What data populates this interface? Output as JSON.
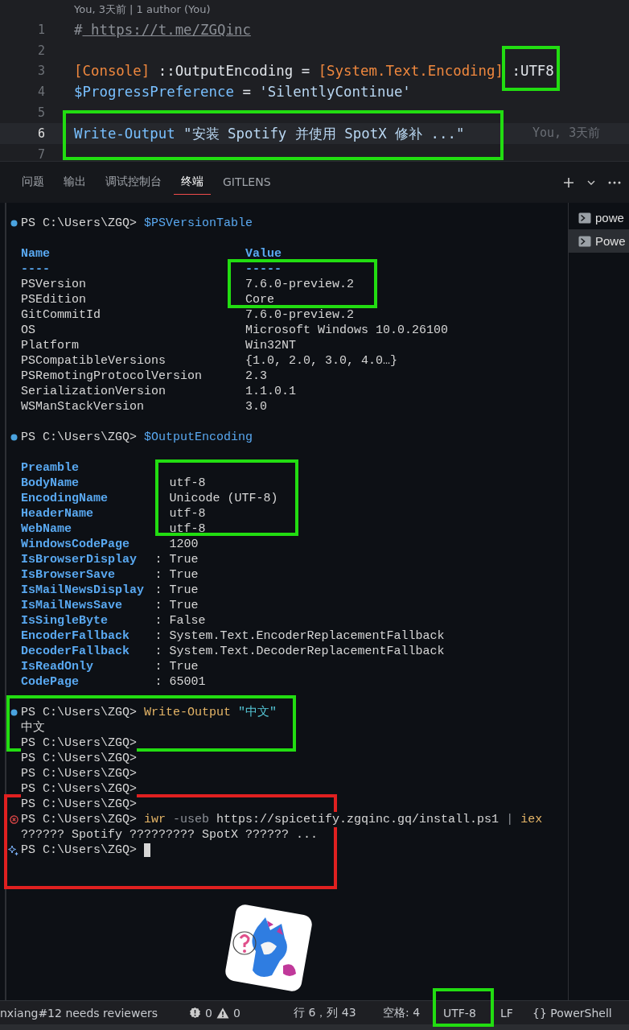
{
  "editor": {
    "blame_header": "You, 3天前 | 1 author (You)",
    "lines": [
      {
        "number": "1",
        "current": false,
        "tokens": [
          {
            "kind": "comment",
            "text": "#"
          },
          {
            "kind": "link",
            "text": "https://t.me/ZGQinc"
          }
        ]
      },
      {
        "number": "2",
        "current": false
      },
      {
        "number": "3",
        "current": false,
        "tokens": [
          {
            "kind": "type",
            "text": "[Console]"
          },
          {
            "kind": "plain",
            "text": "::OutputEncoding ="
          },
          {
            "kind": "type",
            "text": "[System.Text.Encoding]"
          },
          {
            "kind": "plain",
            "text": ":UTF8"
          }
        ]
      },
      {
        "number": "4",
        "current": false,
        "tokens": [
          {
            "kind": "variable",
            "text": "$ProgressPreference"
          },
          {
            "kind": "plain",
            "text": "="
          },
          {
            "kind": "string",
            "text": "'SilentlyContinue'"
          }
        ]
      },
      {
        "number": "5",
        "current": false
      },
      {
        "number": "6",
        "current": true,
        "blame": "You, 3天前",
        "tokens": [
          {
            "kind": "command",
            "text": "Write-Output"
          },
          {
            "kind": "string",
            "text": "\"安装 Spotify 并使用 SpotX 修补 ...\""
          }
        ]
      },
      {
        "number": "7",
        "current": false
      }
    ]
  },
  "panel_tabs": [
    {
      "label": "问题",
      "selected": false
    },
    {
      "label": "输出",
      "selected": false
    },
    {
      "label": "调试控制台",
      "selected": false
    },
    {
      "label": "终端",
      "selected": true
    },
    {
      "label": "GITLENS",
      "selected": false
    }
  ],
  "terminal": {
    "lines": [
      {
        "kind": "prompt",
        "marker": {
          "kind": "success"
        },
        "prompt": "PS C:\\Users\\ZGQ>",
        "tokens": [
          {
            "kind": "variable",
            "text": "$PSVersionTable"
          }
        ]
      },
      {
        "kind": "blank"
      },
      {
        "kind": "table-head",
        "name": "Name",
        "value": "Value"
      },
      {
        "kind": "table-rule",
        "name": "----",
        "value": "-----"
      },
      {
        "kind": "table-row",
        "name": "PSVersion",
        "value": "7.6.0-preview.2"
      },
      {
        "kind": "table-row",
        "name": "PSEdition",
        "value": "Core"
      },
      {
        "kind": "table-row",
        "name": "GitCommitId",
        "value": "7.6.0-preview.2"
      },
      {
        "kind": "table-row",
        "name": "OS",
        "value": "Microsoft Windows 10.0.26100"
      },
      {
        "kind": "table-row",
        "name": "Platform",
        "value": "Win32NT"
      },
      {
        "kind": "table-row",
        "name": "PSCompatibleVersions",
        "value": "{1.0, 2.0, 3.0, 4.0…}"
      },
      {
        "kind": "table-row",
        "name": "PSRemotingProtocolVersion",
        "value": "2.3"
      },
      {
        "kind": "table-row",
        "name": "SerializationVersion",
        "value": "1.1.0.1"
      },
      {
        "kind": "table-row",
        "name": "WSManStackVersion",
        "value": "3.0"
      },
      {
        "kind": "blank"
      },
      {
        "kind": "prompt",
        "marker": {
          "kind": "success"
        },
        "prompt": "PS C:\\Users\\ZGQ>",
        "tokens": [
          {
            "kind": "variable",
            "text": "$OutputEncoding"
          }
        ]
      },
      {
        "kind": "blank"
      },
      {
        "kind": "prop-row",
        "name": "Preamble"
      },
      {
        "kind": "prop-row",
        "name": "BodyName",
        "value": "utf-8"
      },
      {
        "kind": "prop-row",
        "name": "EncodingName",
        "value": "Unicode (UTF-8)"
      },
      {
        "kind": "prop-row",
        "name": "HeaderName",
        "value": "utf-8"
      },
      {
        "kind": "prop-row",
        "name": "WebName",
        "value": "utf-8"
      },
      {
        "kind": "prop-row",
        "name": "WindowsCodePage",
        "value": "1200"
      },
      {
        "kind": "prop-row",
        "name": "IsBrowserDisplay",
        "separator": ":",
        "value": "True"
      },
      {
        "kind": "prop-row",
        "name": "IsBrowserSave",
        "separator": ":",
        "value": "True"
      },
      {
        "kind": "prop-row",
        "name": "IsMailNewsDisplay",
        "separator": ":",
        "value": "True"
      },
      {
        "kind": "prop-row",
        "name": "IsMailNewsSave",
        "separator": ":",
        "value": "True"
      },
      {
        "kind": "prop-row",
        "name": "IsSingleByte",
        "separator": ":",
        "value": "False"
      },
      {
        "kind": "prop-row",
        "name": "EncoderFallback",
        "separator": ":",
        "value": "System.Text.EncoderReplacementFallback"
      },
      {
        "kind": "prop-row",
        "name": "DecoderFallback",
        "separator": ":",
        "value": "System.Text.DecoderReplacementFallback"
      },
      {
        "kind": "prop-row",
        "name": "IsReadOnly",
        "separator": ":",
        "value": "True"
      },
      {
        "kind": "prop-row",
        "name": "CodePage",
        "separator": ":",
        "value": "65001"
      },
      {
        "kind": "blank"
      },
      {
        "kind": "prompt",
        "marker": {
          "kind": "success"
        },
        "prompt": "PS C:\\Users\\ZGQ>",
        "tokens": [
          {
            "kind": "command",
            "text": "Write-Output"
          },
          {
            "kind": "string",
            "text": "\"中文\""
          }
        ]
      },
      {
        "kind": "output",
        "text": "中文"
      },
      {
        "kind": "prompt",
        "prompt": "PS C:\\Users\\ZGQ>"
      },
      {
        "kind": "prompt",
        "prompt": "PS C:\\Users\\ZGQ>"
      },
      {
        "kind": "prompt",
        "prompt": "PS C:\\Users\\ZGQ>"
      },
      {
        "kind": "prompt",
        "prompt": "PS C:\\Users\\ZGQ>"
      },
      {
        "kind": "prompt",
        "prompt": "PS C:\\Users\\ZGQ>"
      },
      {
        "kind": "prompt",
        "marker": {
          "kind": "error"
        },
        "prompt": "PS C:\\Users\\ZGQ>",
        "tokens": [
          {
            "kind": "command",
            "text": "iwr"
          },
          {
            "kind": "parameter",
            "text": "-useb"
          },
          {
            "kind": "plain",
            "text": "https://spicetify.zgqinc.gq/install.ps1"
          },
          {
            "kind": "operator",
            "text": "|"
          },
          {
            "kind": "command",
            "text": "iex"
          }
        ]
      },
      {
        "kind": "output",
        "text": "?????? Spotify ????????? SpotX ?????? ..."
      },
      {
        "kind": "prompt",
        "marker": {
          "kind": "sparkle"
        },
        "prompt": "PS C:\\Users\\ZGQ>",
        "cursor": true
      }
    ]
  },
  "terminal_list": [
    {
      "label": "powe",
      "selected": false
    },
    {
      "label": "Powe",
      "selected": true
    }
  ],
  "status_bar": {
    "branch_note": "nxiang#12 needs reviewers",
    "errors": "0",
    "warnings": "0",
    "position": "行 6，列 43",
    "indent": "空格: 4",
    "encoding": "UTF-8",
    "eol": "LF",
    "language_icon": "{}",
    "language": "PowerShell"
  },
  "highlights": [
    {
      "color": "#22dd11"
    },
    {
      "color": "#22dd11"
    },
    {
      "color": "#22dd11"
    },
    {
      "color": "#22dd11"
    },
    {
      "color": "#22dd11"
    },
    {
      "color": "#e02020"
    },
    {
      "color": "#22dd11"
    }
  ]
}
